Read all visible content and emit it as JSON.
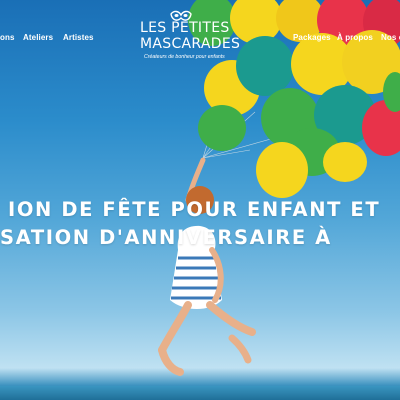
{
  "nav": {
    "left_items": [
      {
        "label": "ons"
      },
      {
        "label": "Ateliers"
      },
      {
        "label": "Artistes"
      }
    ],
    "right_items": [
      {
        "label": "Packages"
      },
      {
        "label": "À propos"
      },
      {
        "label": "Nos c"
      }
    ]
  },
  "logo": {
    "line1": "LES PETITES",
    "line2": "MASCARADES",
    "tagline": "Créateurs de bonheur pour enfants"
  },
  "hero": {
    "headline_line1": "ION DE FÊTE POUR ENFANT ET",
    "headline_line2": "SATION D'ANNIVERSAIRE À"
  },
  "colors": {
    "sky_top": "#1a6fb6",
    "text": "#ffffff",
    "balloon_green": "#3fae49",
    "balloon_yellow": "#f5d61e",
    "balloon_red": "#e8334a",
    "balloon_teal": "#1b9a8f"
  }
}
